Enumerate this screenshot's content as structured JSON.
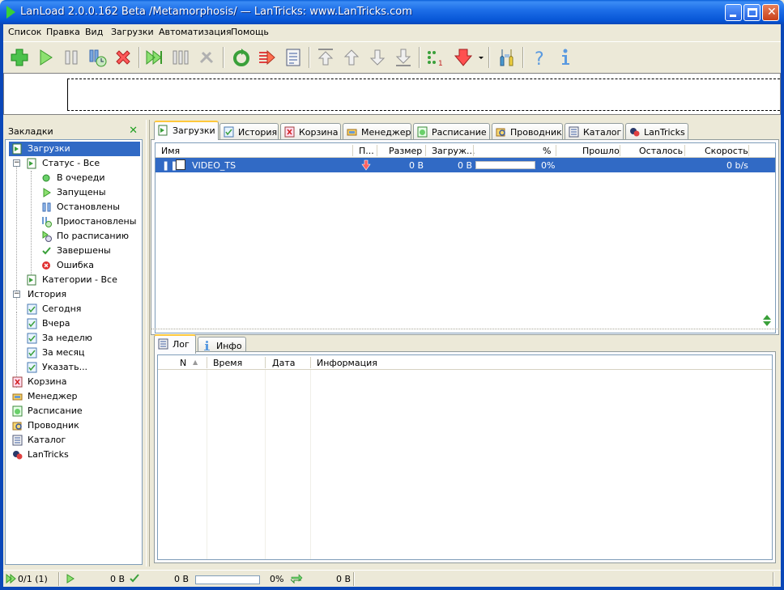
{
  "window": {
    "title": "LanLoad 2.0.0.162 Beta /Metamorphosis/ — LanTricks: www.LanTricks.com"
  },
  "menu": [
    "Список",
    "Правка",
    "Вид",
    "Загрузки",
    "Автоматизация",
    "Помощь"
  ],
  "toolbar": {
    "buttons": [
      "add-icon",
      "start-icon",
      "pause-icon",
      "pause-schedule-icon",
      "delete-icon",
      "start-all-icon",
      "pause-all-icon",
      "tools-icon",
      "refresh-icon",
      "speed-icon",
      "properties-icon",
      "move-top-icon",
      "move-up-icon",
      "move-down-icon",
      "move-bottom-icon",
      "queue-icon",
      "priority-icon",
      "settings-icon",
      "help-icon",
      "info-icon"
    ]
  },
  "bookmarks": {
    "title": "Закладки",
    "items": [
      {
        "label": "Загрузки",
        "icon": "downloads-icon"
      },
      {
        "label": "Статус - Все",
        "icon": "downloads-icon"
      },
      {
        "label": "В очереди",
        "icon": "queue-dot-icon"
      },
      {
        "label": "Запущены",
        "icon": "play-icon"
      },
      {
        "label": "Остановлены",
        "icon": "pause-icon"
      },
      {
        "label": "Приостановлены",
        "icon": "pause-clock-icon"
      },
      {
        "label": "По расписанию",
        "icon": "schedule-icon"
      },
      {
        "label": "Завершены",
        "icon": "check-icon"
      },
      {
        "label": "Ошибка",
        "icon": "error-icon"
      },
      {
        "label": "Категории - Все",
        "icon": "downloads-icon"
      },
      {
        "label": "История",
        "icon": "history-icon"
      },
      {
        "label": "Сегодня",
        "icon": "history-icon"
      },
      {
        "label": "Вчера",
        "icon": "history-icon"
      },
      {
        "label": "За неделю",
        "icon": "history-icon"
      },
      {
        "label": "За месяц",
        "icon": "history-icon"
      },
      {
        "label": "Указать...",
        "icon": "history-icon"
      },
      {
        "label": "Корзина",
        "icon": "trash-icon"
      },
      {
        "label": "Менеджер",
        "icon": "manager-icon"
      },
      {
        "label": "Расписание",
        "icon": "schedule-green-icon"
      },
      {
        "label": "Проводник",
        "icon": "explorer-icon"
      },
      {
        "label": "Каталог",
        "icon": "catalog-icon"
      },
      {
        "label": "LanTricks",
        "icon": "lantricks-icon"
      }
    ]
  },
  "tabs": [
    "Загрузки",
    "История",
    "Корзина",
    "Менеджер",
    "Расписание",
    "Проводник",
    "Каталог",
    "LanTricks"
  ],
  "downloads": {
    "columns": [
      "Имя",
      "П...",
      "Размер",
      "Загруж...",
      "%",
      "Прошло",
      "Осталось",
      "Скорость"
    ],
    "rows": [
      {
        "name": "VIDEO_TS",
        "size": "0 B",
        "loaded": "0 B",
        "percent": "0%",
        "elapsed": "",
        "remaining": "",
        "speed": "0 b/s"
      }
    ]
  },
  "bottom_tabs": [
    "Лог",
    "Инфо"
  ],
  "log": {
    "columns": [
      "N",
      "Время",
      "Дата",
      "Информация"
    ]
  },
  "status": {
    "count": "0/1 (1)",
    "speed_down": "0 B",
    "done": "0 B",
    "percent": "0%",
    "transfer": "0 B"
  }
}
